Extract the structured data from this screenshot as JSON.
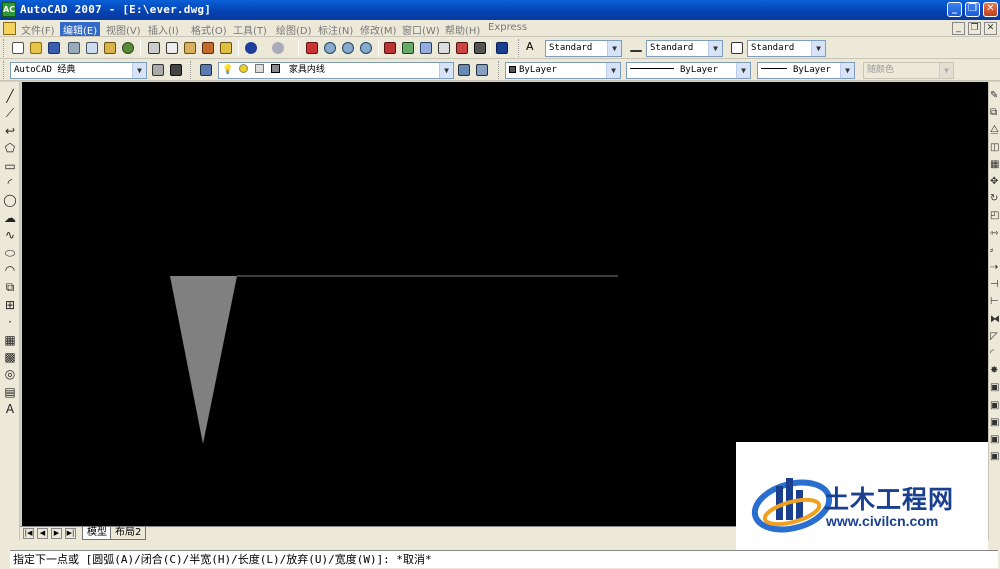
{
  "window": {
    "title": "AutoCAD 2007 - [E:\\ever.dwg]",
    "app_icon_text": "AC"
  },
  "menu": {
    "items": [
      "文件(F)",
      "编辑(E)",
      "视图(V)",
      "插入(I)",
      "格式(O)",
      "工具(T)",
      "绘图(D)",
      "标注(N)",
      "修改(M)",
      "窗口(W)",
      "帮助(H)",
      "Express"
    ],
    "active_index": 1
  },
  "styles_toolbar": {
    "text_style": "Standard",
    "dim_style": "Standard",
    "table_style": "Standard"
  },
  "workspace": {
    "name": "AutoCAD 经典"
  },
  "layer": {
    "current": "家具内线"
  },
  "properties": {
    "color": "ByLayer",
    "linetype": "ByLayer",
    "lineweight": "ByLayer",
    "plot_style": "随颜色"
  },
  "layout_tabs": {
    "tabs": [
      "模型",
      "布局2"
    ],
    "active_index": 0
  },
  "command_line": {
    "text": "指定下一点或 [圆弧(A)/闭合(C)/半宽(H)/长度(L)/放弃(U)/宽度(W)]: *取消*"
  },
  "watermark": {
    "title": "土木工程网",
    "url": "www.civilcn.com"
  },
  "colors": {
    "canvas_bg": "#000000",
    "drawing_fill": "#808080",
    "drawing_line": "#7a7a7a",
    "menu_active": "#316ac5",
    "title_bar": "#0a4fc8",
    "watermark_blue": "#1a3f8f"
  },
  "icons": {
    "left_draw": [
      "line-icon",
      "construction-line-icon",
      "polyline-icon",
      "polygon-icon",
      "rectangle-icon",
      "arc-icon",
      "circle-icon",
      "revision-cloud-icon",
      "spline-icon",
      "ellipse-icon",
      "ellipse-arc-icon",
      "insert-block-icon",
      "make-block-icon",
      "point-icon",
      "hatch-icon",
      "gradient-icon",
      "region-icon",
      "table-icon",
      "multiline-text-icon"
    ],
    "left_draw_glyphs": [
      "╱",
      "⟋",
      "↩",
      "⬠",
      "▭",
      "◜",
      "◯",
      "☁",
      "∿",
      "⬭",
      "◠",
      "⧉",
      "⊞",
      "·",
      "▦",
      "▩",
      "◎",
      "▤",
      "A"
    ]
  }
}
